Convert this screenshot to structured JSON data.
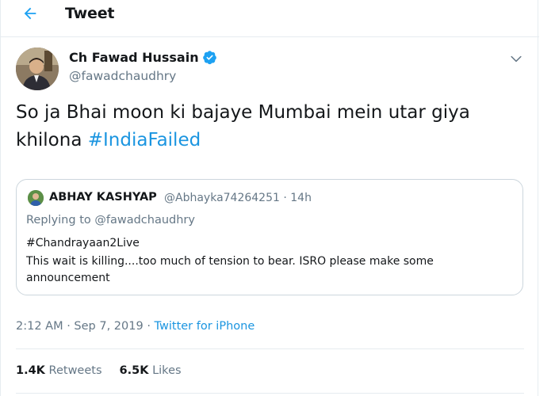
{
  "header": {
    "back_icon": "arrow-left-icon",
    "title": "Tweet"
  },
  "tweet": {
    "author": {
      "name": "Ch Fawad Hussain",
      "handle": "@fawadchaudhry",
      "verified_icon": "verified-badge-icon",
      "avatar_icon": "avatar"
    },
    "menu_icon": "chevron-down-icon",
    "text_plain": "So ja Bhai moon ki bajaye Mumbai mein utar giya khilona ",
    "hashtag": "#IndiaFailed",
    "timestamp": "2:12 AM · Sep 7, 2019 · ",
    "source": "Twitter for iPhone",
    "retweets_count": "1.4K",
    "retweets_label": "Retweets",
    "likes_count": "6.5K",
    "likes_label": "Likes"
  },
  "quoted": {
    "name": "ABHAY KASHYAP",
    "handle_time": "@Abhayka74264251 · 14h",
    "replying_to": "Replying to @fawadchaudhry",
    "hashtag_line": "#Chandrayaan2Live",
    "body": "This wait is killing....too much of tension to bear. ISRO please make some announcement"
  },
  "colors": {
    "accent": "#1b95e0",
    "muted": "#657786",
    "text": "#14171a",
    "border": "#e6ecf0"
  }
}
